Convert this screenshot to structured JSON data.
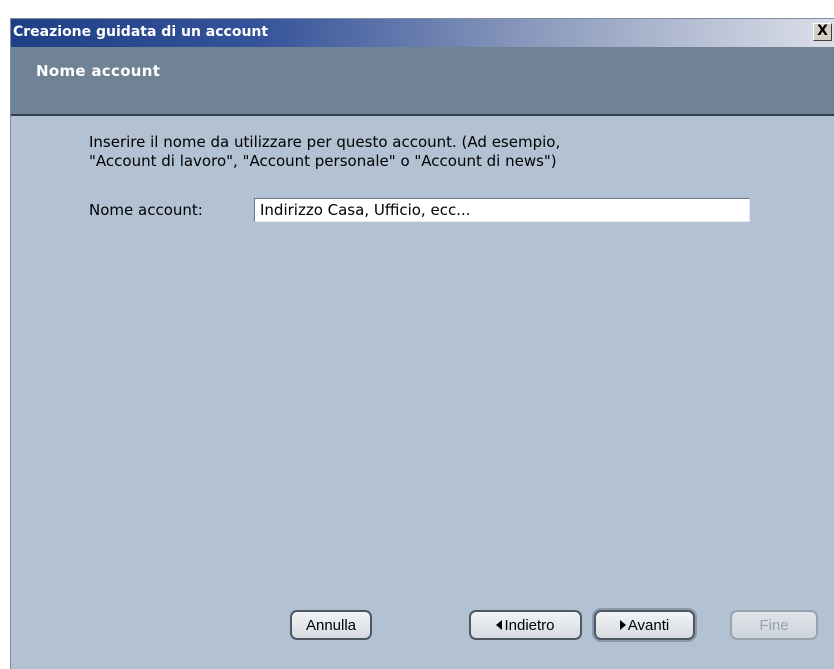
{
  "window": {
    "title": "Creazione guidata di un account",
    "close_label": "X"
  },
  "header": {
    "title": "Nome account"
  },
  "content": {
    "description_line1": "Inserire il nome da utilizzare per questo account. (Ad esempio,",
    "description_line2": "\"Account di lavoro\", \"Account personale\" o \"Account di news\")",
    "field_label": "Nome account:",
    "field_value": "Indirizzo Casa, Ufficio, ecc..."
  },
  "buttons": {
    "cancel": "Annulla",
    "back": "Indietro",
    "next": "Avanti",
    "finish": "Fine"
  }
}
